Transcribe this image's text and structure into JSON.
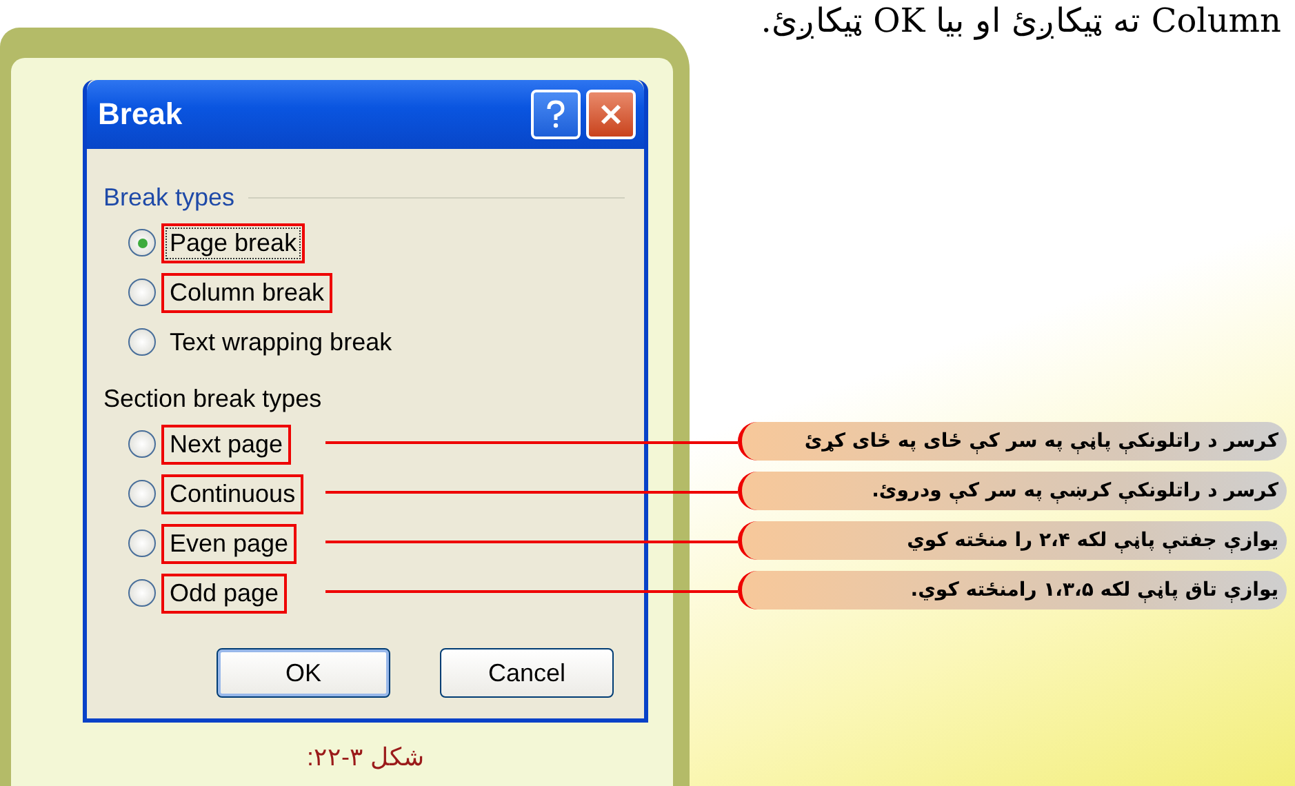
{
  "heading": "Column ته ټیکاږئ او بیا OK ټیکاږئ.",
  "dialog": {
    "title": "Break",
    "groups": [
      {
        "label": "Break types",
        "options": [
          {
            "label": "Page break",
            "selected": true,
            "highlighted": true
          },
          {
            "label": "Column break",
            "selected": false,
            "highlighted": true
          },
          {
            "label": "Text wrapping break",
            "selected": false,
            "highlighted": false
          }
        ]
      },
      {
        "label": "Section break types",
        "options": [
          {
            "label": "Next page",
            "selected": false,
            "highlighted": true
          },
          {
            "label": "Continuous",
            "selected": false,
            "highlighted": true
          },
          {
            "label": "Even page",
            "selected": false,
            "highlighted": true
          },
          {
            "label": "Odd page",
            "selected": false,
            "highlighted": true
          }
        ]
      }
    ],
    "ok_button": {
      "label": "OK",
      "default": true
    },
    "cancel_button": {
      "label": "Cancel",
      "default": false
    }
  },
  "callouts": [
    "کرسر د راتلونکې پاڼې په سر کې ځای په ځای کړئ",
    "کرسر د راتلونکې کرښې په سر کې ودروئ.",
    "یوازې جفتې پاڼې لکه ۲،۴ را منځته کوي",
    "یوازې تاق پاڼې لکه ۱،۳،۵ رامنځته کوي."
  ],
  "caption": "شکل ۳-۲۲:"
}
